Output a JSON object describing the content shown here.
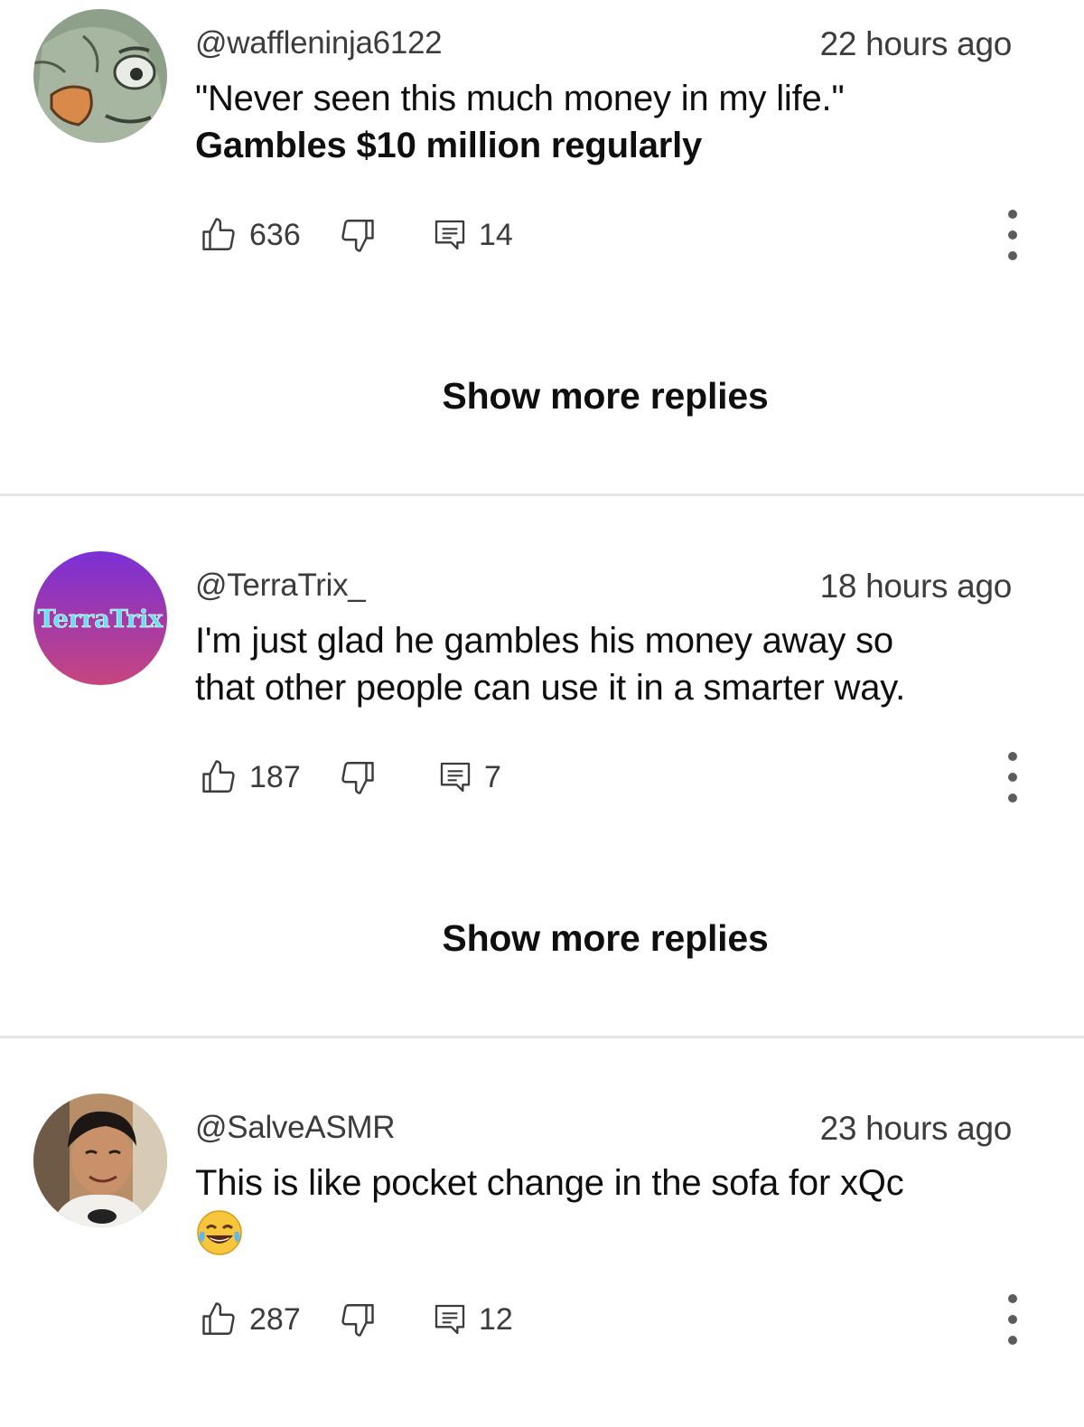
{
  "comments": [
    {
      "handle": "@waffleninja6122",
      "time": "22 hours ago",
      "lines": [
        "\"Never seen this much money in my life.\"",
        "Gambles $10 million regularly"
      ],
      "likes": "636",
      "replies": "14",
      "show_more": "Show more replies"
    },
    {
      "handle": "@TerraTrix_",
      "time": "18 hours ago",
      "avatar_text": "TerraTrix",
      "lines": [
        "I'm just glad he gambles his money away so",
        "that other people can use it in a smarter way."
      ],
      "likes": "187",
      "replies": "7",
      "show_more": "Show more replies"
    },
    {
      "handle": "@SalveASMR",
      "time": "23 hours ago",
      "lines": [
        "This is like pocket change in the sofa for xQc"
      ],
      "emoji": "face-with-tears-of-joy",
      "likes": "287",
      "replies": "12"
    }
  ],
  "icons": {
    "like": "thumbs-up-icon",
    "dislike": "thumbs-down-icon",
    "reply": "reply-comment-icon",
    "menu": "more-vert-icon"
  },
  "colors": {
    "text": "#0f0f0f",
    "secondary": "#3c3c3c",
    "divider": "#e4e4e4",
    "terratrix_gradient_top": "#7b2fd6",
    "terratrix_gradient_bottom": "#c7457e"
  }
}
